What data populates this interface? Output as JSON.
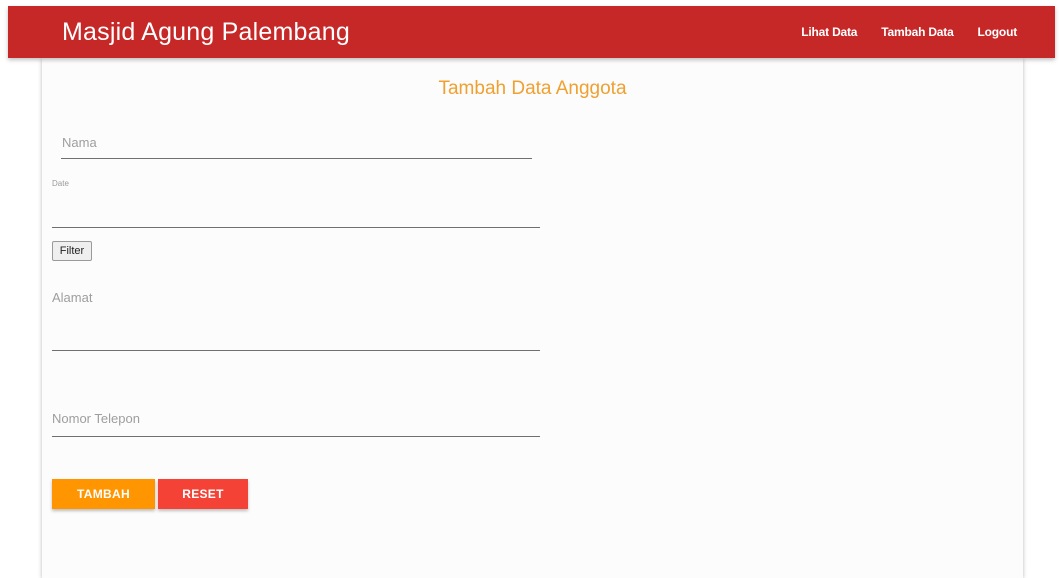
{
  "navbar": {
    "brand": "Masjid Agung Palembang",
    "links": [
      "Lihat Data",
      "Tambah Data",
      "Logout"
    ],
    "color": "#c62828"
  },
  "form": {
    "title": "Tambah Data Anggota",
    "fields": {
      "nama": {
        "placeholder": "Nama",
        "value": ""
      },
      "date": {
        "label": "Date",
        "value": ""
      },
      "alamat": {
        "label": "Alamat",
        "value": ""
      },
      "telepon": {
        "label": "Nomor Telepon",
        "value": ""
      }
    },
    "filter_label": "Filter",
    "buttons": {
      "tambah": "TAMBAH",
      "reset": "RESET"
    },
    "accent_color": "#ff9500",
    "reset_color": "#f44336"
  }
}
